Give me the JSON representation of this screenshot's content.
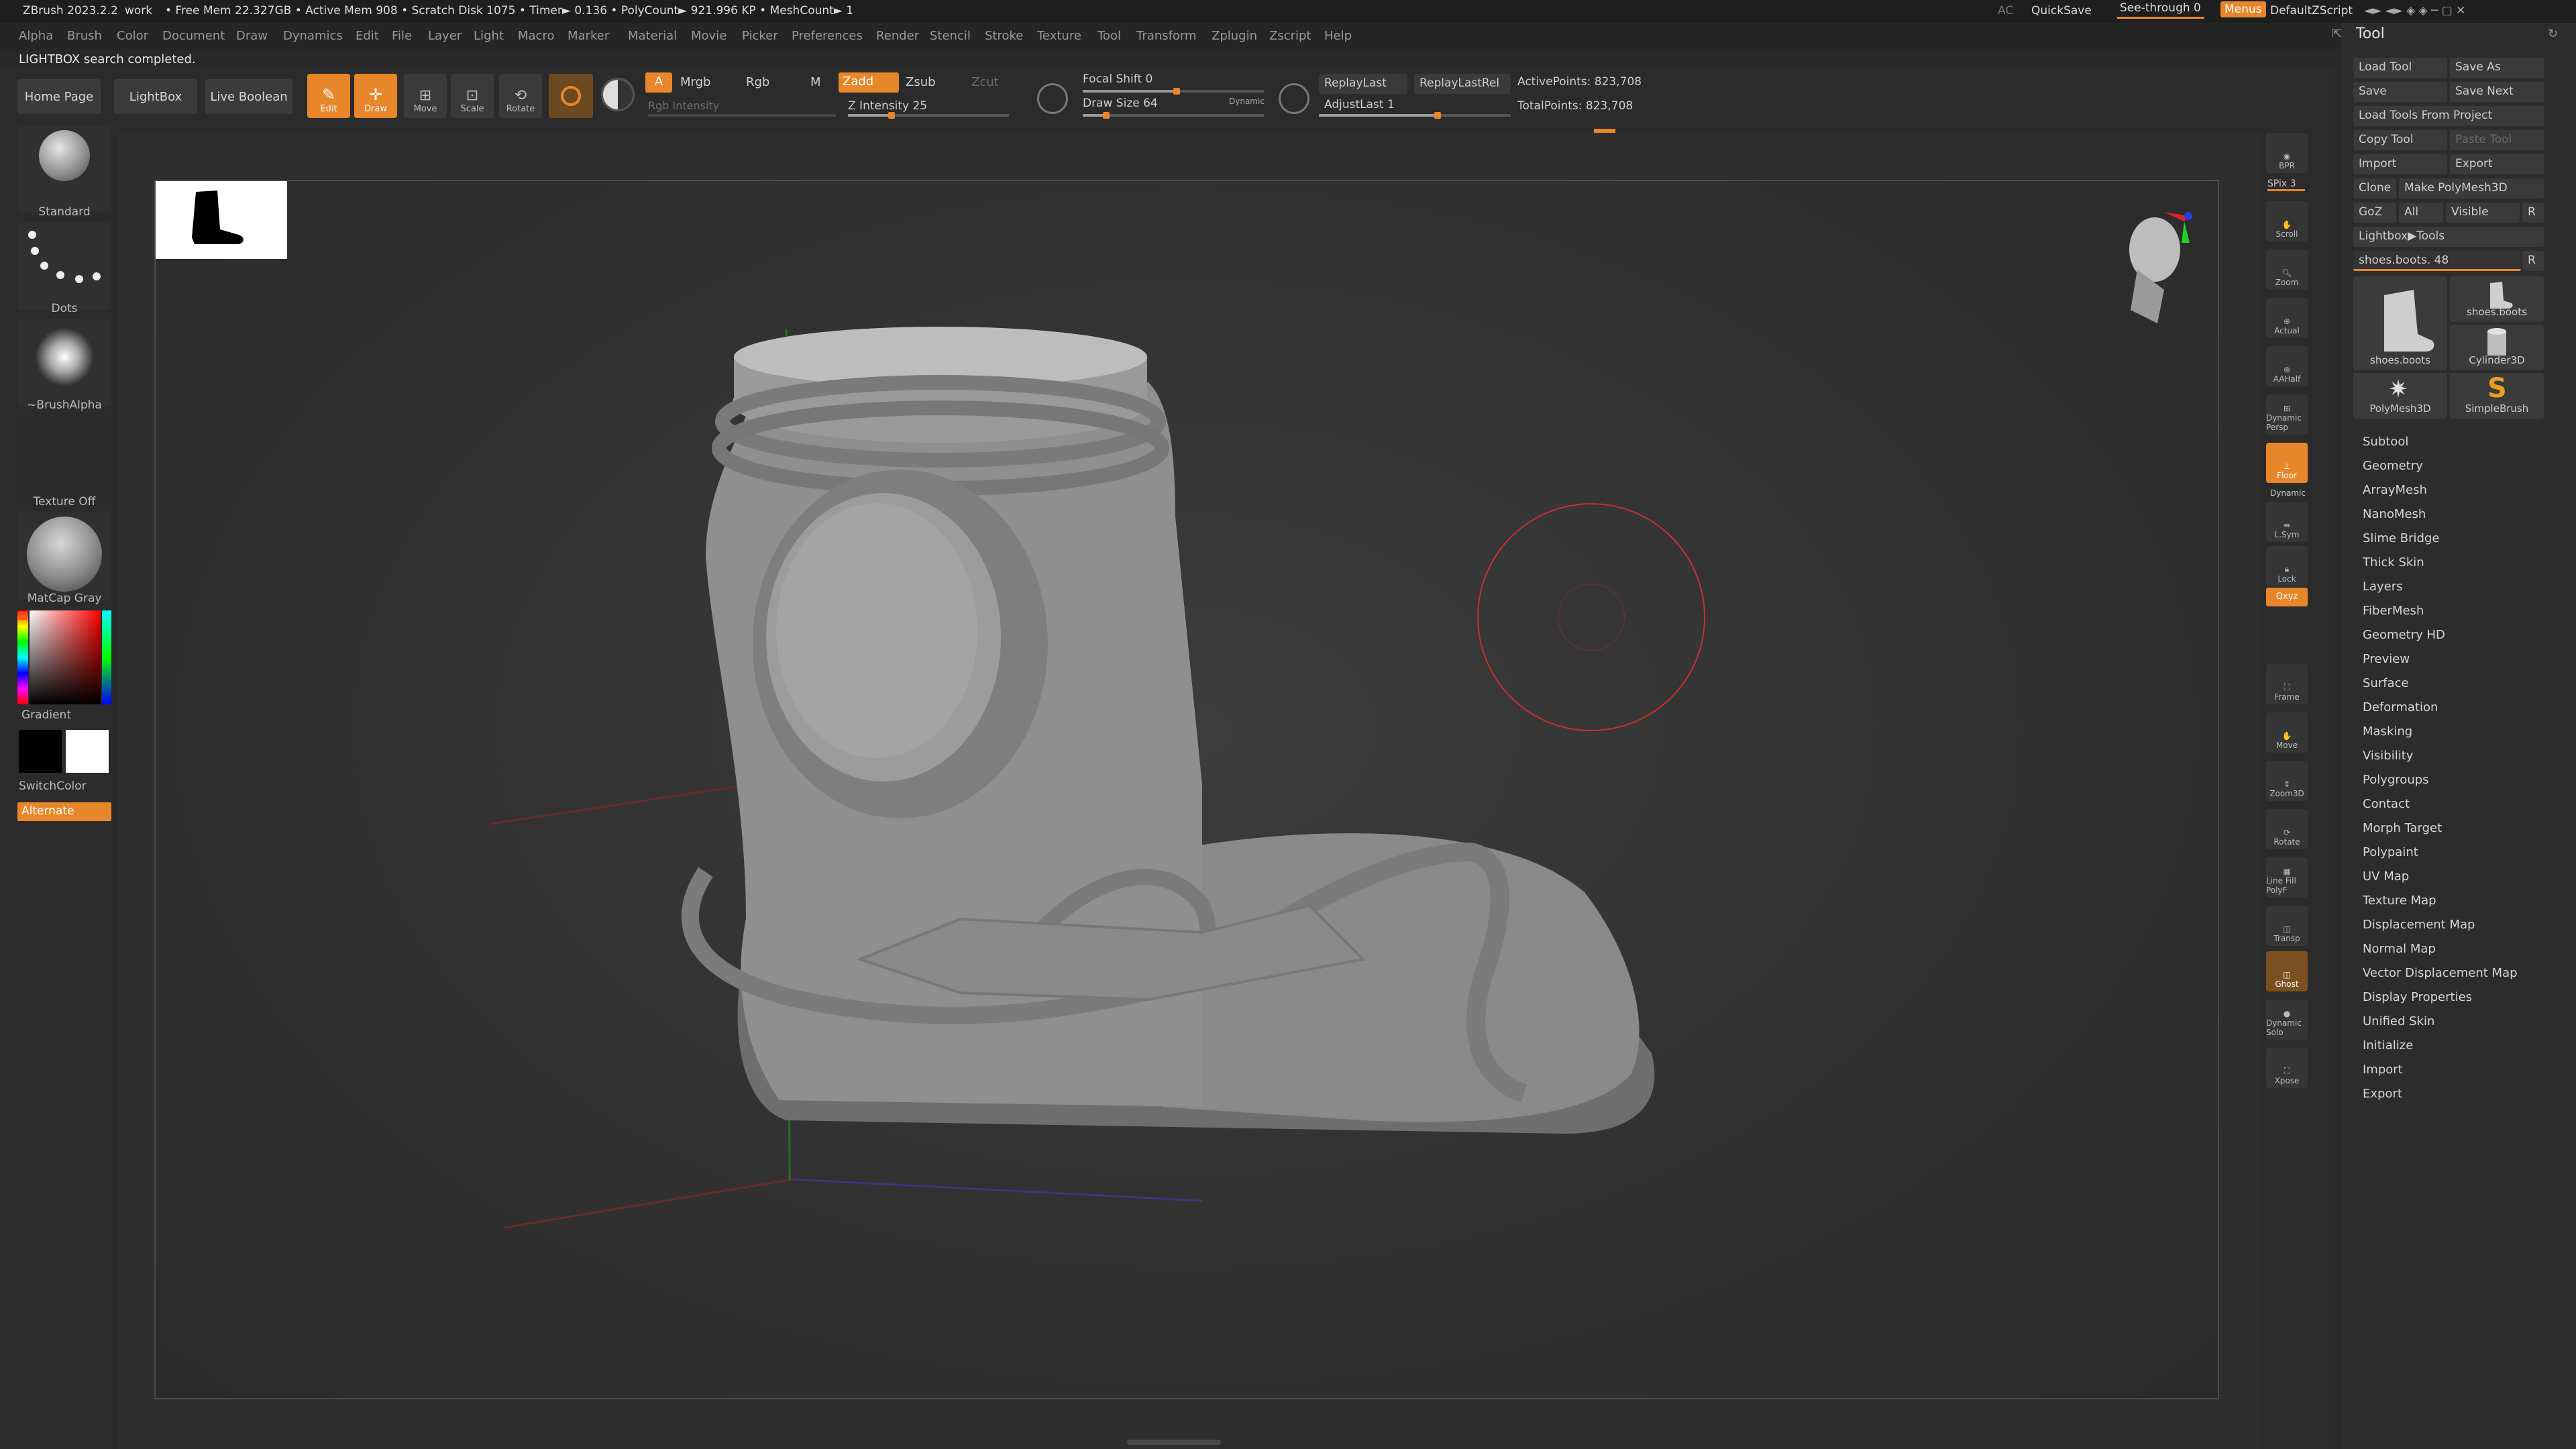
{
  "titlebar": {
    "app": "ZBrush 2023.2.2",
    "project": "work",
    "stats": "• Free Mem 22.327GB • Active Mem 908 • Scratch Disk 1075 • Timer► 0.136 • PolyCount► 921.996 KP • MeshCount► 1",
    "ac": "AC",
    "quicksave": "QuickSave",
    "seethrough": "See-through  0",
    "menus": "Menus",
    "zscript": "DefaultZScript"
  },
  "menubar": [
    "Alpha",
    "Brush",
    "Color",
    "Document",
    "Draw",
    "Dynamics",
    "Edit",
    "File",
    "Layer",
    "Light",
    "Macro",
    "Marker",
    "Material",
    "Movie",
    "Picker",
    "Preferences",
    "Render",
    "Stencil",
    "Stroke",
    "Texture",
    "Tool",
    "Transform",
    "Zplugin",
    "Zscript",
    "Help"
  ],
  "status": "LIGHTBOX search completed.",
  "toolbar": {
    "home": "Home Page",
    "lightbox": "LightBox",
    "liveboolean": "Live Boolean",
    "edit": "Edit",
    "draw": "Draw",
    "move": "Move",
    "scale": "Scale",
    "rotate": "Rotate",
    "a": "A",
    "mrgb": "Mrgb",
    "rgb": "Rgb",
    "m": "M",
    "zadd": "Zadd",
    "zsub": "Zsub",
    "zcut": "Zcut",
    "rgb_intensity": "Rgb Intensity",
    "z_intensity": "Z Intensity 25",
    "focal_shift": "Focal Shift 0",
    "draw_size": "Draw Size 64",
    "dynamic": "Dynamic",
    "replaylast": "ReplayLast",
    "replaylastrel": "ReplayLastRel",
    "adjustlast": "AdjustLast 1",
    "activepoints": "ActivePoints: 823,708",
    "totalpoints": "TotalPoints: 823,708",
    "z_intensity_value": 25,
    "draw_size_value": 64
  },
  "leftshelf": {
    "brush": "Standard",
    "stroke": "Dots",
    "alpha": "~BrushAlpha",
    "texture": "Texture Off",
    "material": "MatCap Gray",
    "gradient": "Gradient",
    "switchcolor": "SwitchColor",
    "alternate": "Alternate"
  },
  "rightshelf": [
    "BPR",
    "SPix 3",
    "Scroll",
    "Zoom",
    "Actual",
    "AAHalf",
    "Dynamic Persp",
    "Floor",
    "Dynamic",
    "L.Sym",
    "Lock",
    "Qxyz",
    "Frame",
    "Move",
    "Zoom3D",
    "Rotate",
    "Line Fill PolyF",
    "Transp",
    "Ghost",
    "Dynamic Solo",
    "Xpose"
  ],
  "toolpanel": {
    "title": "Tool",
    "buttons": {
      "load_tool": "Load Tool",
      "save_as": "Save As",
      "save": "Save",
      "save_next": "Save Next",
      "load_from_project": "Load Tools From Project",
      "copy_tool": "Copy Tool",
      "paste_tool": "Paste Tool",
      "import": "Import",
      "export": "Export",
      "clone": "Clone",
      "make_polymesh": "Make PolyMesh3D",
      "goz": "GoZ",
      "all": "All",
      "visible": "Visible",
      "r": "R",
      "lightbox_tools": "Lightbox▶Tools",
      "current_tool": "shoes.boots. 48"
    },
    "tools": [
      "shoes.boots",
      "shoes.boots",
      "Cylinder3D",
      "PolyMesh3D",
      "SimpleBrush"
    ],
    "subpalettes": [
      "Subtool",
      "Geometry",
      "ArrayMesh",
      "NanoMesh",
      "Slime Bridge",
      "Thick Skin",
      "Layers",
      "FiberMesh",
      "Geometry HD",
      "Preview",
      "Surface",
      "Deformation",
      "Masking",
      "Visibility",
      "Polygroups",
      "Contact",
      "Morph Target",
      "Polypaint",
      "UV Map",
      "Texture Map",
      "Displacement Map",
      "Normal Map",
      "Vector Displacement Map",
      "Display Properties",
      "Unified Skin",
      "Initialize",
      "Import",
      "Export"
    ]
  },
  "colors": {
    "accent": "#e8862a",
    "panel": "#2c2c2c",
    "viewport": "#2e2e2e"
  }
}
